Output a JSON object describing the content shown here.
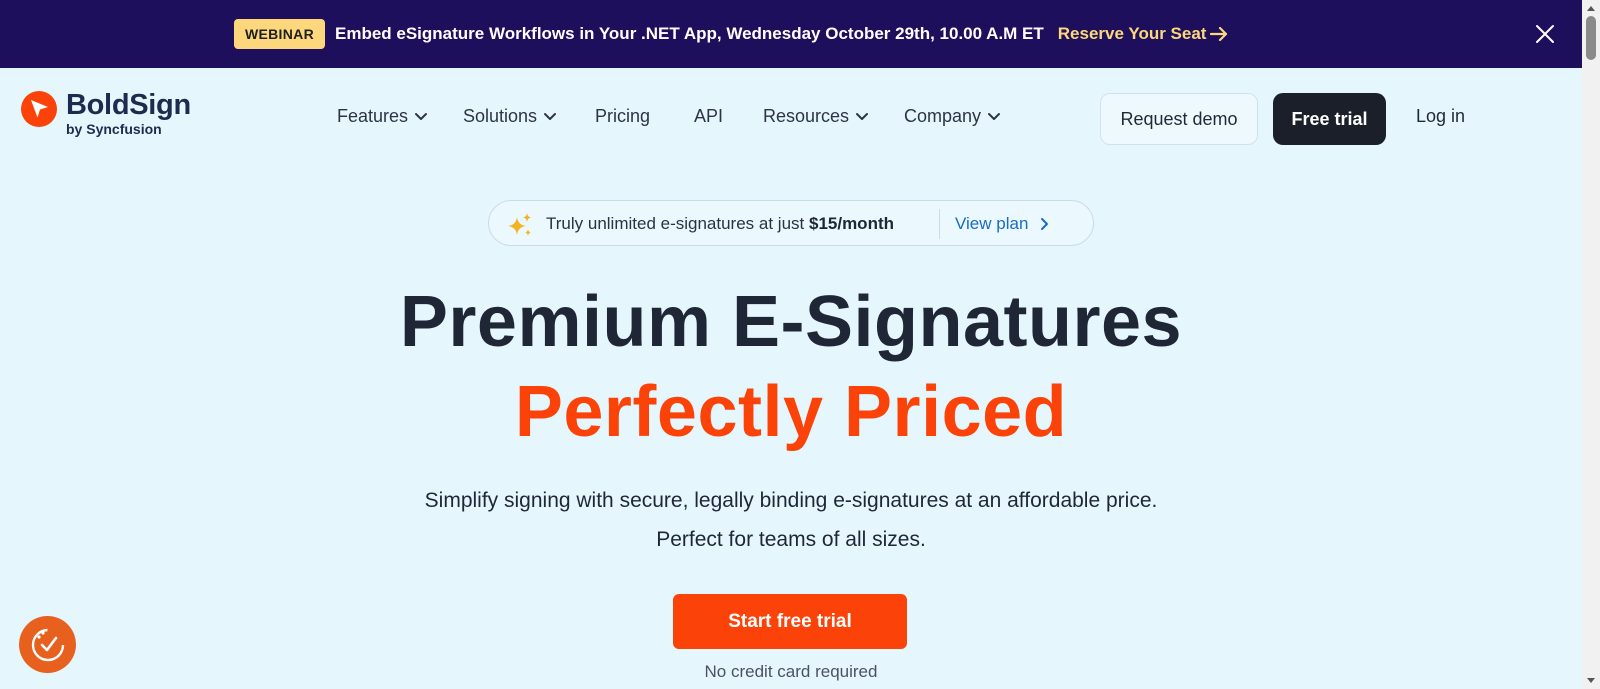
{
  "announcement": {
    "badge": "WEBINAR",
    "text": "Embed eSignature Workflows in Your .NET App, Wednesday October 29th, 10.00 A.M ET",
    "link_label": "Reserve Your Seat",
    "link_icon": "arrow-right-icon",
    "close_icon": "close-icon",
    "bg_color": "#1e0f5c",
    "accent_color": "#fcd77c"
  },
  "logo": {
    "title": "BoldSign",
    "subtitle": "by Syncfusion",
    "icon": "boldsign-logo-icon",
    "color": "#fb4309"
  },
  "nav": {
    "items": [
      {
        "label": "Features",
        "has_dropdown": true
      },
      {
        "label": "Solutions",
        "has_dropdown": true
      },
      {
        "label": "Pricing",
        "has_dropdown": false
      },
      {
        "label": "API",
        "has_dropdown": false
      },
      {
        "label": "Resources",
        "has_dropdown": true
      },
      {
        "label": "Company",
        "has_dropdown": true
      }
    ],
    "request_demo": "Request demo",
    "free_trial": "Free trial",
    "login": "Log in"
  },
  "promo": {
    "icon": "sparkle-icon",
    "text": "Truly unlimited e-signatures at just ",
    "price": "$15/month",
    "link_label": "View plan",
    "link_icon": "chevron-right-icon"
  },
  "hero": {
    "title_line1": "Premium E-Signatures",
    "title_line2": "Perfectly Priced",
    "subtitle_line1": "Simplify signing with secure, legally binding e-signatures at an affordable price.",
    "subtitle_line2": "Perfect for teams of all sizes.",
    "cta_label": "Start free trial",
    "cta_note": "No credit card required",
    "accent_color": "#fb4309"
  },
  "floating_widget": {
    "icon": "accessibility-check-icon"
  }
}
